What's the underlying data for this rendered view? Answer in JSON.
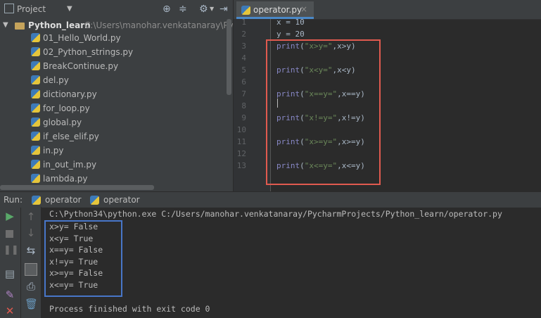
{
  "project": {
    "title": "Project",
    "root_name": "Python_learn",
    "root_path": "C:\\Users\\manohar.venkatanaray\\Pycharm",
    "files": [
      "01_Hello_World.py",
      "02_Python_strings.py",
      "BreakContinue.py",
      "del.py",
      "dictionary.py",
      "for_loop.py",
      "global.py",
      "if_else_elif.py",
      "in.py",
      "in_out_im.py",
      "lambda.py"
    ]
  },
  "editor": {
    "tab_label": "operator.py",
    "line_numbers": [
      "1",
      "2",
      "3",
      "4",
      "5",
      "6",
      "7",
      "8",
      "9",
      "10",
      "11",
      "12",
      "13"
    ],
    "lines": [
      {
        "kind": "assign",
        "text": "x = 10"
      },
      {
        "kind": "assign",
        "text": "y = 20"
      },
      {
        "kind": "print",
        "kw": "print",
        "open": "(",
        "str": "\"x>y=\"",
        "rest": ",x>y)"
      },
      {
        "kind": "blank"
      },
      {
        "kind": "print",
        "kw": "print",
        "open": "(",
        "str": "\"x<y=\"",
        "rest": ",x<y)"
      },
      {
        "kind": "blank"
      },
      {
        "kind": "print",
        "kw": "print",
        "open": "(",
        "str": "\"x==y=\"",
        "rest": ",x==y)"
      },
      {
        "kind": "blank"
      },
      {
        "kind": "print",
        "kw": "print",
        "open": "(",
        "str": "\"x!=y=\"",
        "rest": ",x!=y)"
      },
      {
        "kind": "blank"
      },
      {
        "kind": "print",
        "kw": "print",
        "open": "(",
        "str": "\"x>=y=\"",
        "rest": ",x>=y)"
      },
      {
        "kind": "blank"
      },
      {
        "kind": "print",
        "kw": "print",
        "open": "(",
        "str": "\"x<=y=\"",
        "rest": ",x<=y)"
      }
    ]
  },
  "run": {
    "label": "Run:",
    "tabs": [
      "operator",
      "operator"
    ],
    "command": "C:\\Python34\\python.exe C:/Users/manohar.venkatanaray/PycharmProjects/Python_learn/operator.py",
    "output": [
      "x>y= False",
      "x<y= True",
      "x==y= False",
      "x!=y= True",
      "x>=y= False",
      "x<=y= True"
    ],
    "exit_message": "Process finished with exit code 0"
  },
  "colors": {
    "highlight_red": "#e05a4f",
    "highlight_blue": "#4876c8",
    "tab_underline": "#4a88c7"
  },
  "icons": [
    "project-icon",
    "chevron-down-icon",
    "target-icon",
    "collapse-icon",
    "gear-icon",
    "hide-icon",
    "python-file-icon",
    "run-icon",
    "stop-icon",
    "pause-icon",
    "up-arrow-icon",
    "down-arrow-icon",
    "soft-wrap-icon",
    "dump-threads-icon",
    "print-icon",
    "trash-icon",
    "pin-icon",
    "close-icon"
  ]
}
